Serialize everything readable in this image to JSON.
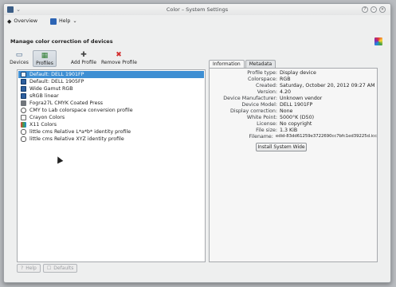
{
  "window": {
    "title": "Color – System Settings",
    "buttons": [
      "?",
      "–",
      "×"
    ]
  },
  "menubar": {
    "overview": "Overview",
    "help": "Help",
    "help_arrow": "⌄"
  },
  "heading": "Manage color correction of devices",
  "toolbar": {
    "devices": "Devices",
    "profiles": "Profiles",
    "add_profile": "Add Profile",
    "remove_profile": "Remove Profile"
  },
  "profiles": [
    {
      "label": "Default: DELL 1901FP",
      "icon": "monitor-icon"
    },
    {
      "label": "Default: DELL 1905FP",
      "icon": "monitor-icon"
    },
    {
      "label": "Wide Gamut RGB",
      "icon": "monitor-icon"
    },
    {
      "label": "sRGB linear",
      "icon": "monitor-icon"
    },
    {
      "label": "Fogra27L CMYK Coated Press",
      "icon": "printer-icon"
    },
    {
      "label": "CMY to Lab colorspace conversion profile",
      "icon": "cycle-icon"
    },
    {
      "label": "Crayon Colors",
      "icon": "crayon-icon"
    },
    {
      "label": "X11 Colors",
      "icon": "x11-icon"
    },
    {
      "label": "little cms Relative L*a*b* identity profile",
      "icon": "glasses-icon"
    },
    {
      "label": "little cms Relative XYZ identity profile",
      "icon": "glasses-icon"
    }
  ],
  "tabs": {
    "information": "Information",
    "metadata": "Metadata"
  },
  "info": [
    {
      "k": "Profile type:",
      "v": "Display device"
    },
    {
      "k": "Colorspace:",
      "v": "RGB"
    },
    {
      "k": "Created:",
      "v": "Saturday, October 20, 2012 09:27 AM"
    },
    {
      "k": "Version:",
      "v": "4.20"
    },
    {
      "k": "Device Manufacturer:",
      "v": "Unknown vendor"
    },
    {
      "k": "Device Model:",
      "v": "DELL 1901FP"
    },
    {
      "k": "Display correction:",
      "v": "None"
    },
    {
      "k": "White Point:",
      "v": "5000°K (D50)"
    },
    {
      "k": "License:",
      "v": "No copyright"
    },
    {
      "k": "File size:",
      "v": "1.3 KiB"
    },
    {
      "k": "Filename:",
      "v": "edid-83dd61259e3722690cc7bfc1ed39225d.icc"
    }
  ],
  "install_button": "Install System Wide",
  "bottom": {
    "help": "Help",
    "defaults": "Defaults"
  },
  "colors": {
    "selection": "#3e8fd3",
    "remove": "#d32f2f",
    "add": "#444444"
  }
}
